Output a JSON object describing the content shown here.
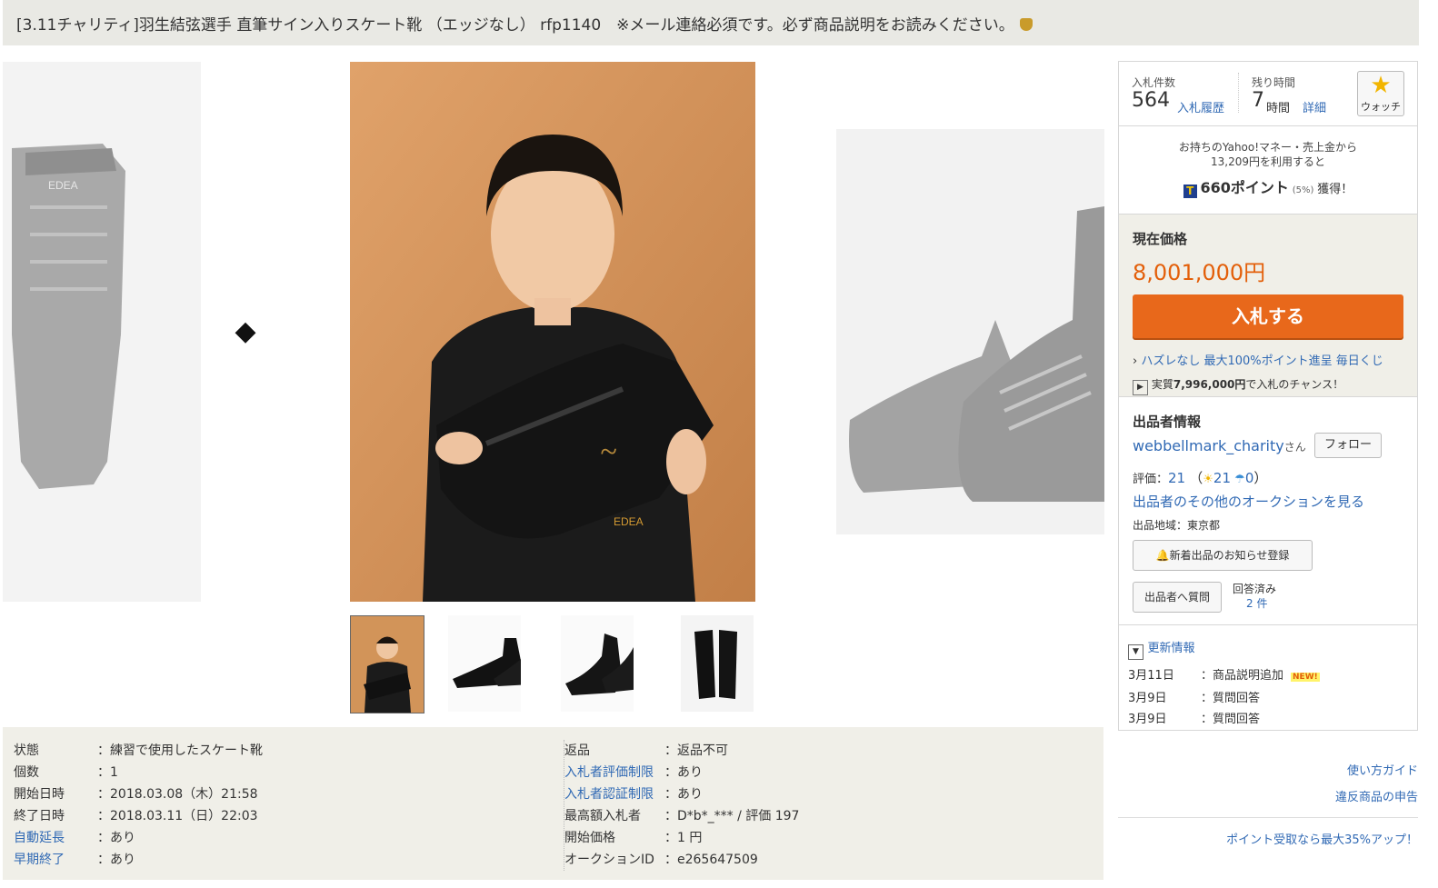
{
  "title": "[3.11チャリティ]羽生結弦選手 直筆サイン入りスケート靴 （エッジなし） rfp1140　※メール連絡必須です。必ず商品説明をお読みください。",
  "title_icon": "bag-icon",
  "gallery": {
    "prev_label": "◆",
    "next_label": "◆",
    "thumbnails": [
      "thumb-photo-1",
      "thumb-photo-2",
      "thumb-photo-3",
      "thumb-photo-4"
    ],
    "selected_index": 0
  },
  "specs_left": [
    {
      "key": "状態",
      "value": "：練習で使用したスケート靴",
      "link": false
    },
    {
      "key": "個数",
      "value": "：1",
      "link": false
    },
    {
      "key": "開始日時",
      "value": "：2018.03.08（木）21:58",
      "link": false
    },
    {
      "key": "終了日時",
      "value": "：2018.03.11（日）22:03",
      "link": false
    },
    {
      "key": "自動延長",
      "value": "：あり",
      "link": true
    },
    {
      "key": "早期終了",
      "value": "：あり",
      "link": true
    }
  ],
  "specs_right": [
    {
      "key": "返品",
      "value": "：返品不可",
      "link": false
    },
    {
      "key": "入札者評価制限",
      "value": "：あり",
      "link": true
    },
    {
      "key": "入札者認証制限",
      "value": "：あり",
      "link": true
    },
    {
      "key": "最高額入札者",
      "value": "：D*b*_*** / 評価 197",
      "link": false
    },
    {
      "key": "開始価格",
      "value": "：1 円",
      "link": false
    },
    {
      "key": "オークションID",
      "value": "：e265647509",
      "link": false
    }
  ],
  "bid": {
    "count_label": "入札件数",
    "count": "564",
    "history_link": "入札履歴",
    "remaining_label": "残り時間",
    "remaining_value": "7",
    "remaining_unit": "時間",
    "detail_link": "詳細",
    "watch_label": "ウォッチ"
  },
  "points": {
    "line1": "お持ちのYahoo!マネー・売上金から",
    "line2": "13,209円を利用すると",
    "points_value": "660ポイント",
    "points_rate": "(5%)",
    "points_suffix": "獲得！"
  },
  "price": {
    "label": "現在価格",
    "value": "8,001,000円",
    "bid_button": "入札する",
    "promo_link": "ハズレなし 最大100%ポイント進呈 毎日くじ",
    "chance_prefix": "実質",
    "chance_amount": "7,996,000円",
    "chance_suffix": "で入札のチャンス！"
  },
  "seller": {
    "heading": "出品者情報",
    "name": "webbellmark_charity",
    "name_suffix": "さん",
    "follow_button": "フォロー",
    "rating_label": "評価：",
    "rating_value": "21",
    "good_value": "21",
    "bad_value": "0",
    "other_auctions_link": "出品者のその他のオークションを見る",
    "region": "出品地域：東京都",
    "notify_button": "新着出品のお知らせ登録",
    "question_button": "出品者へ質問",
    "answered_label": "回答済み",
    "answered_count": "2 件"
  },
  "updates": {
    "heading": "更新情報",
    "rows": [
      {
        "date": "3月11日",
        "text": "：商品説明追加",
        "badge": "NEW!"
      },
      {
        "date": "3月9日",
        "text": "：質問回答",
        "badge": ""
      },
      {
        "date": "3月9日",
        "text": "：質問回答",
        "badge": ""
      }
    ]
  },
  "footer_links": {
    "guide": "使い方ガイド",
    "report": "違反商品の申告",
    "promo": "ポイント受取なら最大35%アップ！"
  },
  "colors": {
    "accent": "#e8681b",
    "price": "#e35f0a",
    "link": "#3069b4",
    "panel": "#f0efe8"
  }
}
